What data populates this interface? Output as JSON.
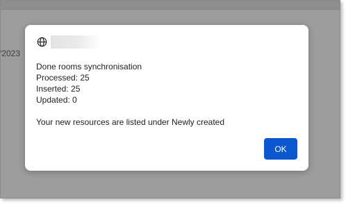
{
  "background": {
    "partial_date_text": "/2023"
  },
  "dialog": {
    "icon": "globe-icon",
    "message_lines": [
      "Done rooms synchronisation",
      "Processed: 25",
      "Inserted: 25",
      "Updated: 0"
    ],
    "note": "Your new resources are listed under Newly created",
    "ok_label": "OK"
  },
  "colors": {
    "accent": "#0b57d0",
    "overlay": "#9d9d9d",
    "dialog_bg": "#ffffff",
    "text": "#202124"
  }
}
